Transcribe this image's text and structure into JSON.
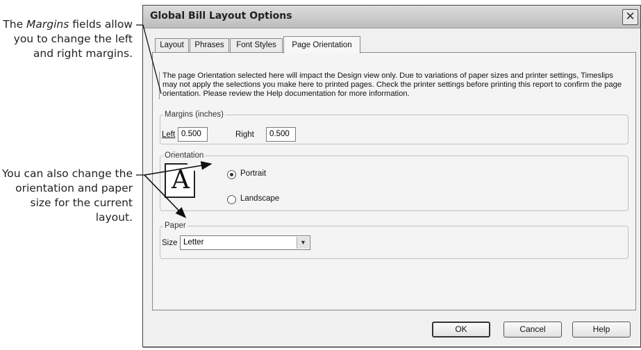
{
  "callouts": {
    "margins": {
      "prefix": "The ",
      "emphasis": "Margins",
      "rest": " fields allow you to change the left and right margins."
    },
    "orientation": "You can also change the orientation and paper size for the current layout."
  },
  "dialog": {
    "title": "Global Bill Layout Options",
    "close_glyph": "✕",
    "tabs": [
      "Layout",
      "Phrases",
      "Font Styles",
      "Page Orientation"
    ],
    "active_tab": "Page Orientation",
    "info_text": "The page Orientation selected here will impact the Design view only. Due to variations of paper sizes and printer settings, Timeslips may not apply the selections you make here to printed pages. Check the printer settings before printing this report to confirm the page orientation. Please review the Help documentation for more information.",
    "margins": {
      "legend": "Margins (inches)",
      "left_label": "Left",
      "left_value": "0.500",
      "right_label": "Right",
      "right_value": "0.500"
    },
    "orientation": {
      "legend": "Orientation",
      "icon_letter": "A",
      "portrait_label": "Portrait",
      "landscape_label": "Landscape",
      "selected": "Portrait"
    },
    "paper": {
      "legend": "Paper",
      "size_label": "Size",
      "size_value": "Letter"
    },
    "buttons": {
      "ok": "OK",
      "cancel": "Cancel",
      "help": "Help"
    }
  }
}
